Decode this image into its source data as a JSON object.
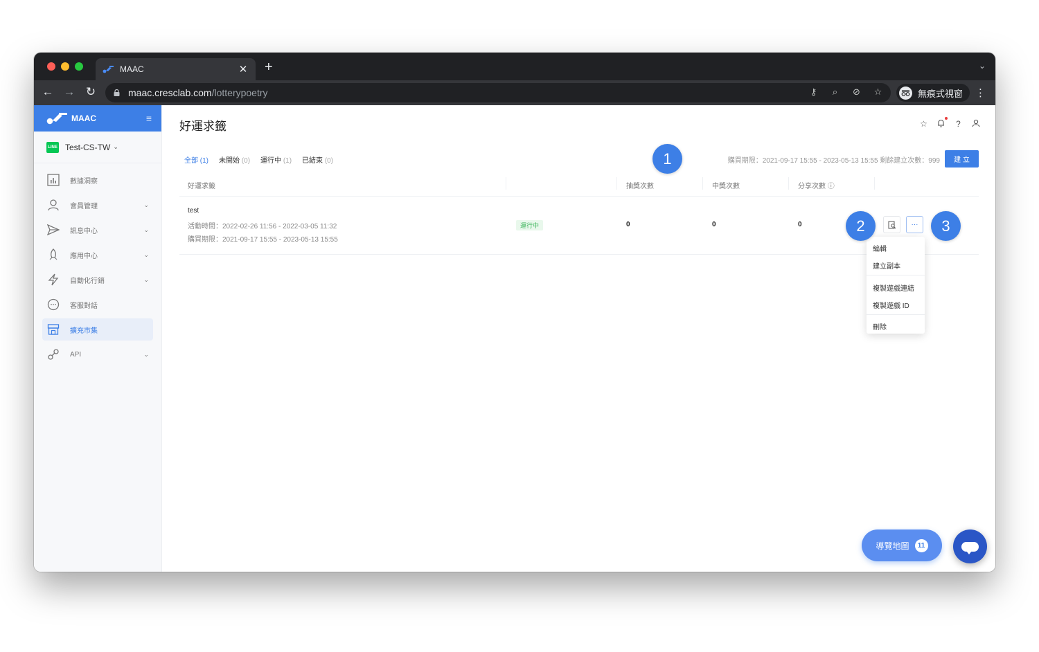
{
  "browser": {
    "tab_title": "MAAC",
    "tab_close": "✕",
    "new_tab": "+",
    "tab_menu": "⌄",
    "url_host": "maac.cresclab.com",
    "url_path": "/lotterypoetry",
    "incognito_label": "無痕式視窗",
    "menu": "⋮"
  },
  "sidebar": {
    "brand": "MAAC",
    "channel": "Test-CS-TW",
    "line_badge": "LINE",
    "items": [
      {
        "label": "數據洞察",
        "icon": "chart-icon",
        "has_caret": false
      },
      {
        "label": "會員管理",
        "icon": "user-icon",
        "has_caret": true
      },
      {
        "label": "訊息中心",
        "icon": "send-icon",
        "has_caret": true
      },
      {
        "label": "應用中心",
        "icon": "rocket-icon",
        "has_caret": true
      },
      {
        "label": "自動化行銷",
        "icon": "lightning-icon",
        "has_caret": true
      },
      {
        "label": "客服對話",
        "icon": "chat-icon",
        "has_caret": false
      },
      {
        "label": "擴充市集",
        "icon": "store-icon",
        "has_caret": false,
        "active": true
      },
      {
        "label": "API",
        "icon": "api-icon",
        "has_caret": true
      }
    ]
  },
  "page": {
    "title": "好運求籤",
    "filters": [
      {
        "label": "全部",
        "count": "(1)",
        "active": true
      },
      {
        "label": "未開始",
        "count": "(0)"
      },
      {
        "label": "運行中",
        "count": "(1)"
      },
      {
        "label": "已結束",
        "count": "(0)"
      }
    ],
    "quota": "購買期限：2021-09-17 15:55 - 2023-05-13 15:55  剩餘建立次數：999",
    "create_button": "建 立",
    "columns": [
      "好運求籤",
      "抽獎次數",
      "中獎次數",
      "分享次數 ⓘ"
    ],
    "row": {
      "name": "test",
      "period": "活動時間：2022-02-26 11:56 - 2022-03-05 11:32",
      "purchase": "購買期限：2021-09-17 15:55 - 2023-05-13 15:55",
      "status": "運行中",
      "draws": "0",
      "wins": "0",
      "shares": "0"
    },
    "more_button": "···",
    "dropdown": [
      "編輯",
      "建立副本",
      "複製遊戲連結",
      "複製遊戲 ID",
      "刪除"
    ]
  },
  "callouts": [
    "1",
    "2",
    "3"
  ],
  "tour": {
    "label": "導覽地圖",
    "badge": "11"
  },
  "colors": {
    "accent": "#3d7fe6",
    "success": "#3bb55a",
    "chrome": "#202124"
  }
}
